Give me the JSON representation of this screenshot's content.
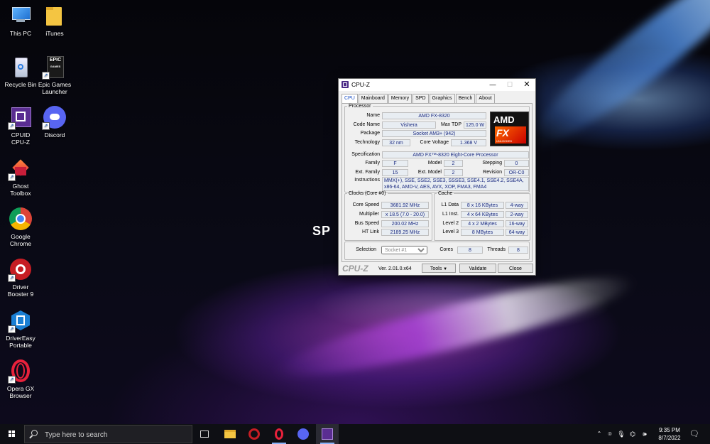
{
  "desktop": {
    "icons": [
      {
        "label": "This PC"
      },
      {
        "label": "iTunes"
      },
      {
        "label": "Recycle Bin"
      },
      {
        "label": "Epic Games\nLauncher"
      },
      {
        "label": "CPUID\nCPU-Z"
      },
      {
        "label": "Discord"
      },
      {
        "label": "Ghost\nToolbox"
      },
      {
        "label": "Google\nChrome"
      },
      {
        "label": "Driver\nBooster 9"
      },
      {
        "label": "DriverEasy\nPortable"
      },
      {
        "label": "Opera GX\nBrowser"
      }
    ],
    "wallpaper_text": "SP"
  },
  "window": {
    "title": "CPU-Z",
    "tabs": [
      "CPU",
      "Mainboard",
      "Memory",
      "SPD",
      "Graphics",
      "Bench",
      "About"
    ],
    "active_tab": "CPU",
    "processor": {
      "legend": "Processor",
      "name_label": "Name",
      "name": "AMD FX-8320",
      "codename_label": "Code Name",
      "codename": "Vishera",
      "maxtdp_label": "Max TDP",
      "maxtdp": "125.0 W",
      "package_label": "Package",
      "package": "Socket AM3+ (942)",
      "technology_label": "Technology",
      "technology": "32 nm",
      "corevoltage_label": "Core Voltage",
      "corevoltage": "1.368 V",
      "specification_label": "Specification",
      "specification": "AMD FX™-8320 Eight-Core Processor",
      "family_label": "Family",
      "family": "F",
      "model_label": "Model",
      "model": "2",
      "stepping_label": "Stepping",
      "stepping": "0",
      "extfamily_label": "Ext. Family",
      "extfamily": "15",
      "extmodel_label": "Ext. Model",
      "extmodel": "2",
      "revision_label": "Revision",
      "revision": "OR-C0",
      "instructions_label": "Instructions",
      "instructions": "MMX(+), SSE, SSE2, SSE3, SSSE3, SSE4.1, SSE4.2, SSE4A, x86-64, AMD-V, AES, AVX, XOP, FMA3, FMA4",
      "logo_brand": "AMD",
      "logo_fx": "FX",
      "logo_sub": "UNLOCKED"
    },
    "clocks": {
      "legend": "Clocks (Core #0)",
      "corespeed_label": "Core Speed",
      "corespeed": "3681.92 MHz",
      "multiplier_label": "Multiplier",
      "multiplier": "x 18.5 (7.0 - 20.0)",
      "busspeed_label": "Bus Speed",
      "busspeed": "200.02 MHz",
      "htlink_label": "HT Link",
      "htlink": "2189.25 MHz"
    },
    "cache": {
      "legend": "Cache",
      "rows": [
        {
          "label": "L1 Data",
          "size": "8 x 16 KBytes",
          "way": "4-way"
        },
        {
          "label": "L1 Inst.",
          "size": "4 x 64 KBytes",
          "way": "2-way"
        },
        {
          "label": "Level 2",
          "size": "4 x 2 MBytes",
          "way": "16-way"
        },
        {
          "label": "Level 3",
          "size": "8 MBytes",
          "way": "64-way"
        }
      ]
    },
    "selection": {
      "label": "Selection",
      "value": "Socket #1",
      "cores_label": "Cores",
      "cores": "8",
      "threads_label": "Threads",
      "threads": "8"
    },
    "footer": {
      "brand": "CPU-Z",
      "version": "Ver. 2.01.0.x64",
      "tools": "Tools",
      "validate": "Validate",
      "close": "Close"
    }
  },
  "taskbar": {
    "search_placeholder": "Type here to search",
    "time": "9:35 PM",
    "date": "8/7/2022"
  }
}
